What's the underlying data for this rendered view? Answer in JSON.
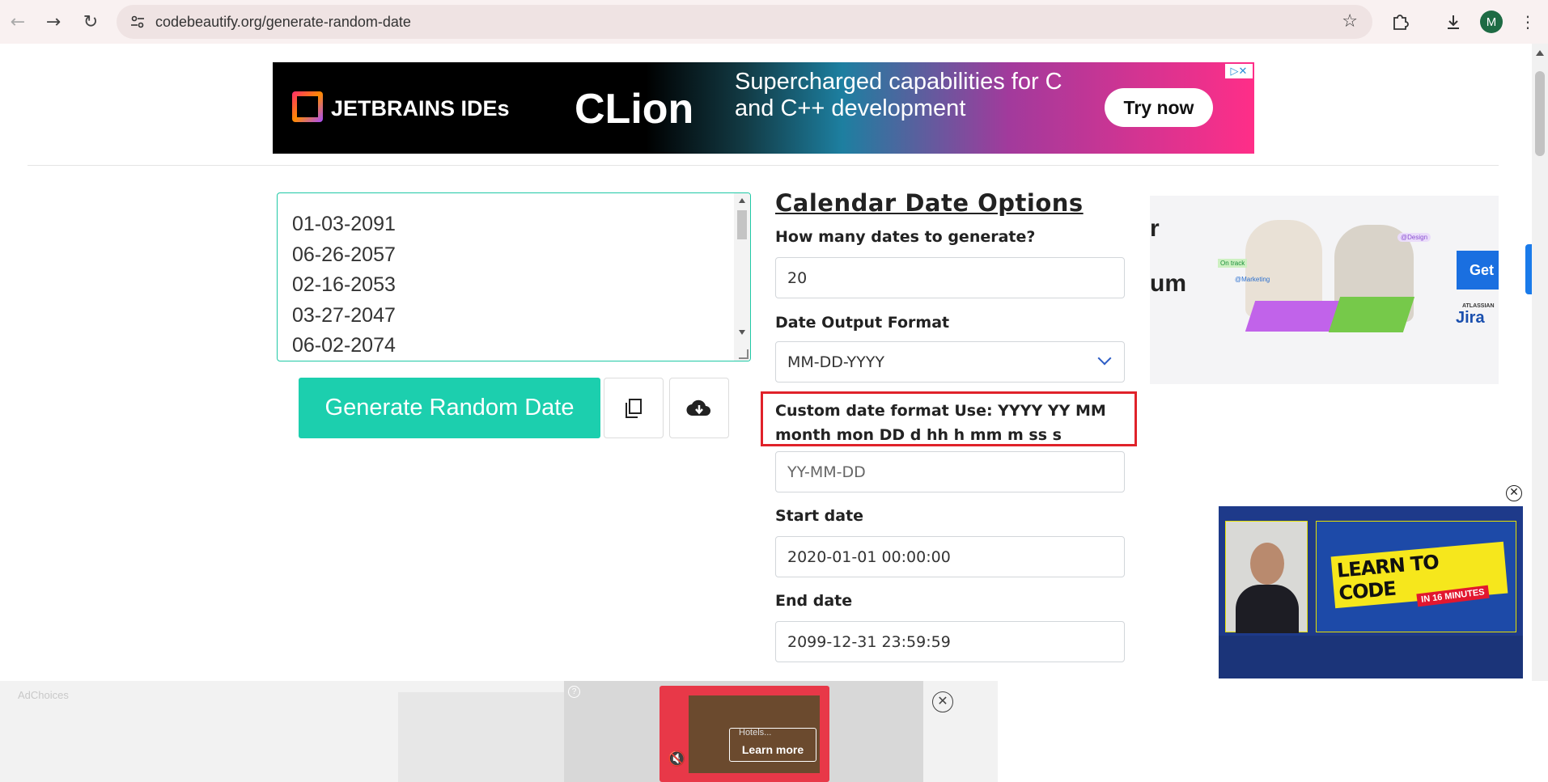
{
  "browser": {
    "url": "codebeautify.org/generate-random-date",
    "avatar_letter": "M"
  },
  "top_ad": {
    "brand": "JETBRAINS IDEs",
    "product": "CLion",
    "tagline": "Supercharged capabilities for C and C++ development",
    "cta": "Try now"
  },
  "output": {
    "dates": [
      "01-03-2091",
      "06-26-2057",
      "02-16-2053",
      "03-27-2047",
      "06-02-2074"
    ]
  },
  "actions": {
    "generate_label": "Generate Random Date"
  },
  "options": {
    "title": "Calendar Date Options",
    "count_label": "How many dates to generate?",
    "count_value": "20",
    "format_label": "Date Output Format",
    "format_value": "MM-DD-YYYY",
    "custom_label": "Custom date format Use: YYYY YY MM month mon DD d hh h mm m ss s",
    "custom_placeholder": "YY-MM-DD",
    "start_label": "Start date",
    "start_value": "2020-01-01 00:00:00",
    "end_label": "End date",
    "end_value": "2099-12-31 23:59:59"
  },
  "side_ad": {
    "text_r": "r",
    "text_um": "um",
    "tag_on_track": "On track",
    "tag_marketing": "@Marketing",
    "tag_design": "@Design",
    "cta": "Get",
    "atlassian": "ATLASSIAN",
    "jira": "Jira"
  },
  "video_ad": {
    "headline": "LEARN TO CODE",
    "subline": "IN 16 MINUTES"
  },
  "bottom_ad": {
    "adchoices": "AdChoices",
    "hotels": "Hotels...",
    "learn_more": "Learn more"
  },
  "colors": {
    "accent": "#1ccfae",
    "highlight_border": "#e0222a",
    "select_chevron": "#2c5cc5"
  }
}
